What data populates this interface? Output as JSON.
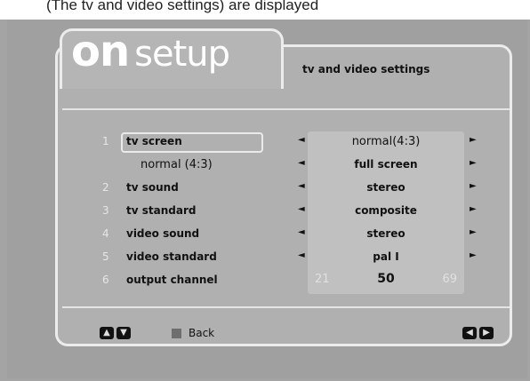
{
  "caption": "(The tv and video settings) are displayed",
  "logo": {
    "on": "on",
    "setup": "setup"
  },
  "header": {
    "title": "tv and video settings"
  },
  "rows": [
    {
      "num": "1",
      "label": "tv screen",
      "value": "normal(4:3)"
    },
    {
      "num": "",
      "label": "normal (4:3)",
      "value": "full screen"
    },
    {
      "num": "2",
      "label": "tv sound",
      "value": "stereo"
    },
    {
      "num": "3",
      "label": "tv standard",
      "value": "composite"
    },
    {
      "num": "4",
      "label": "video sound",
      "value": "stereo"
    },
    {
      "num": "5",
      "label": "video standard",
      "value": "pal I"
    },
    {
      "num": "6",
      "label": "output channel",
      "value": ""
    }
  ],
  "channel": {
    "min": "21",
    "current": "50",
    "max": "69"
  },
  "footer": {
    "back_label": "Back"
  },
  "icons": {
    "arrow_left": "◄",
    "arrow_right": "►",
    "up": "▲",
    "down": "▼",
    "left": "◀",
    "right": "▶"
  },
  "colors": {
    "screen_bg": "#a0a0a0",
    "frame": "#ececec",
    "text": "#111111"
  }
}
